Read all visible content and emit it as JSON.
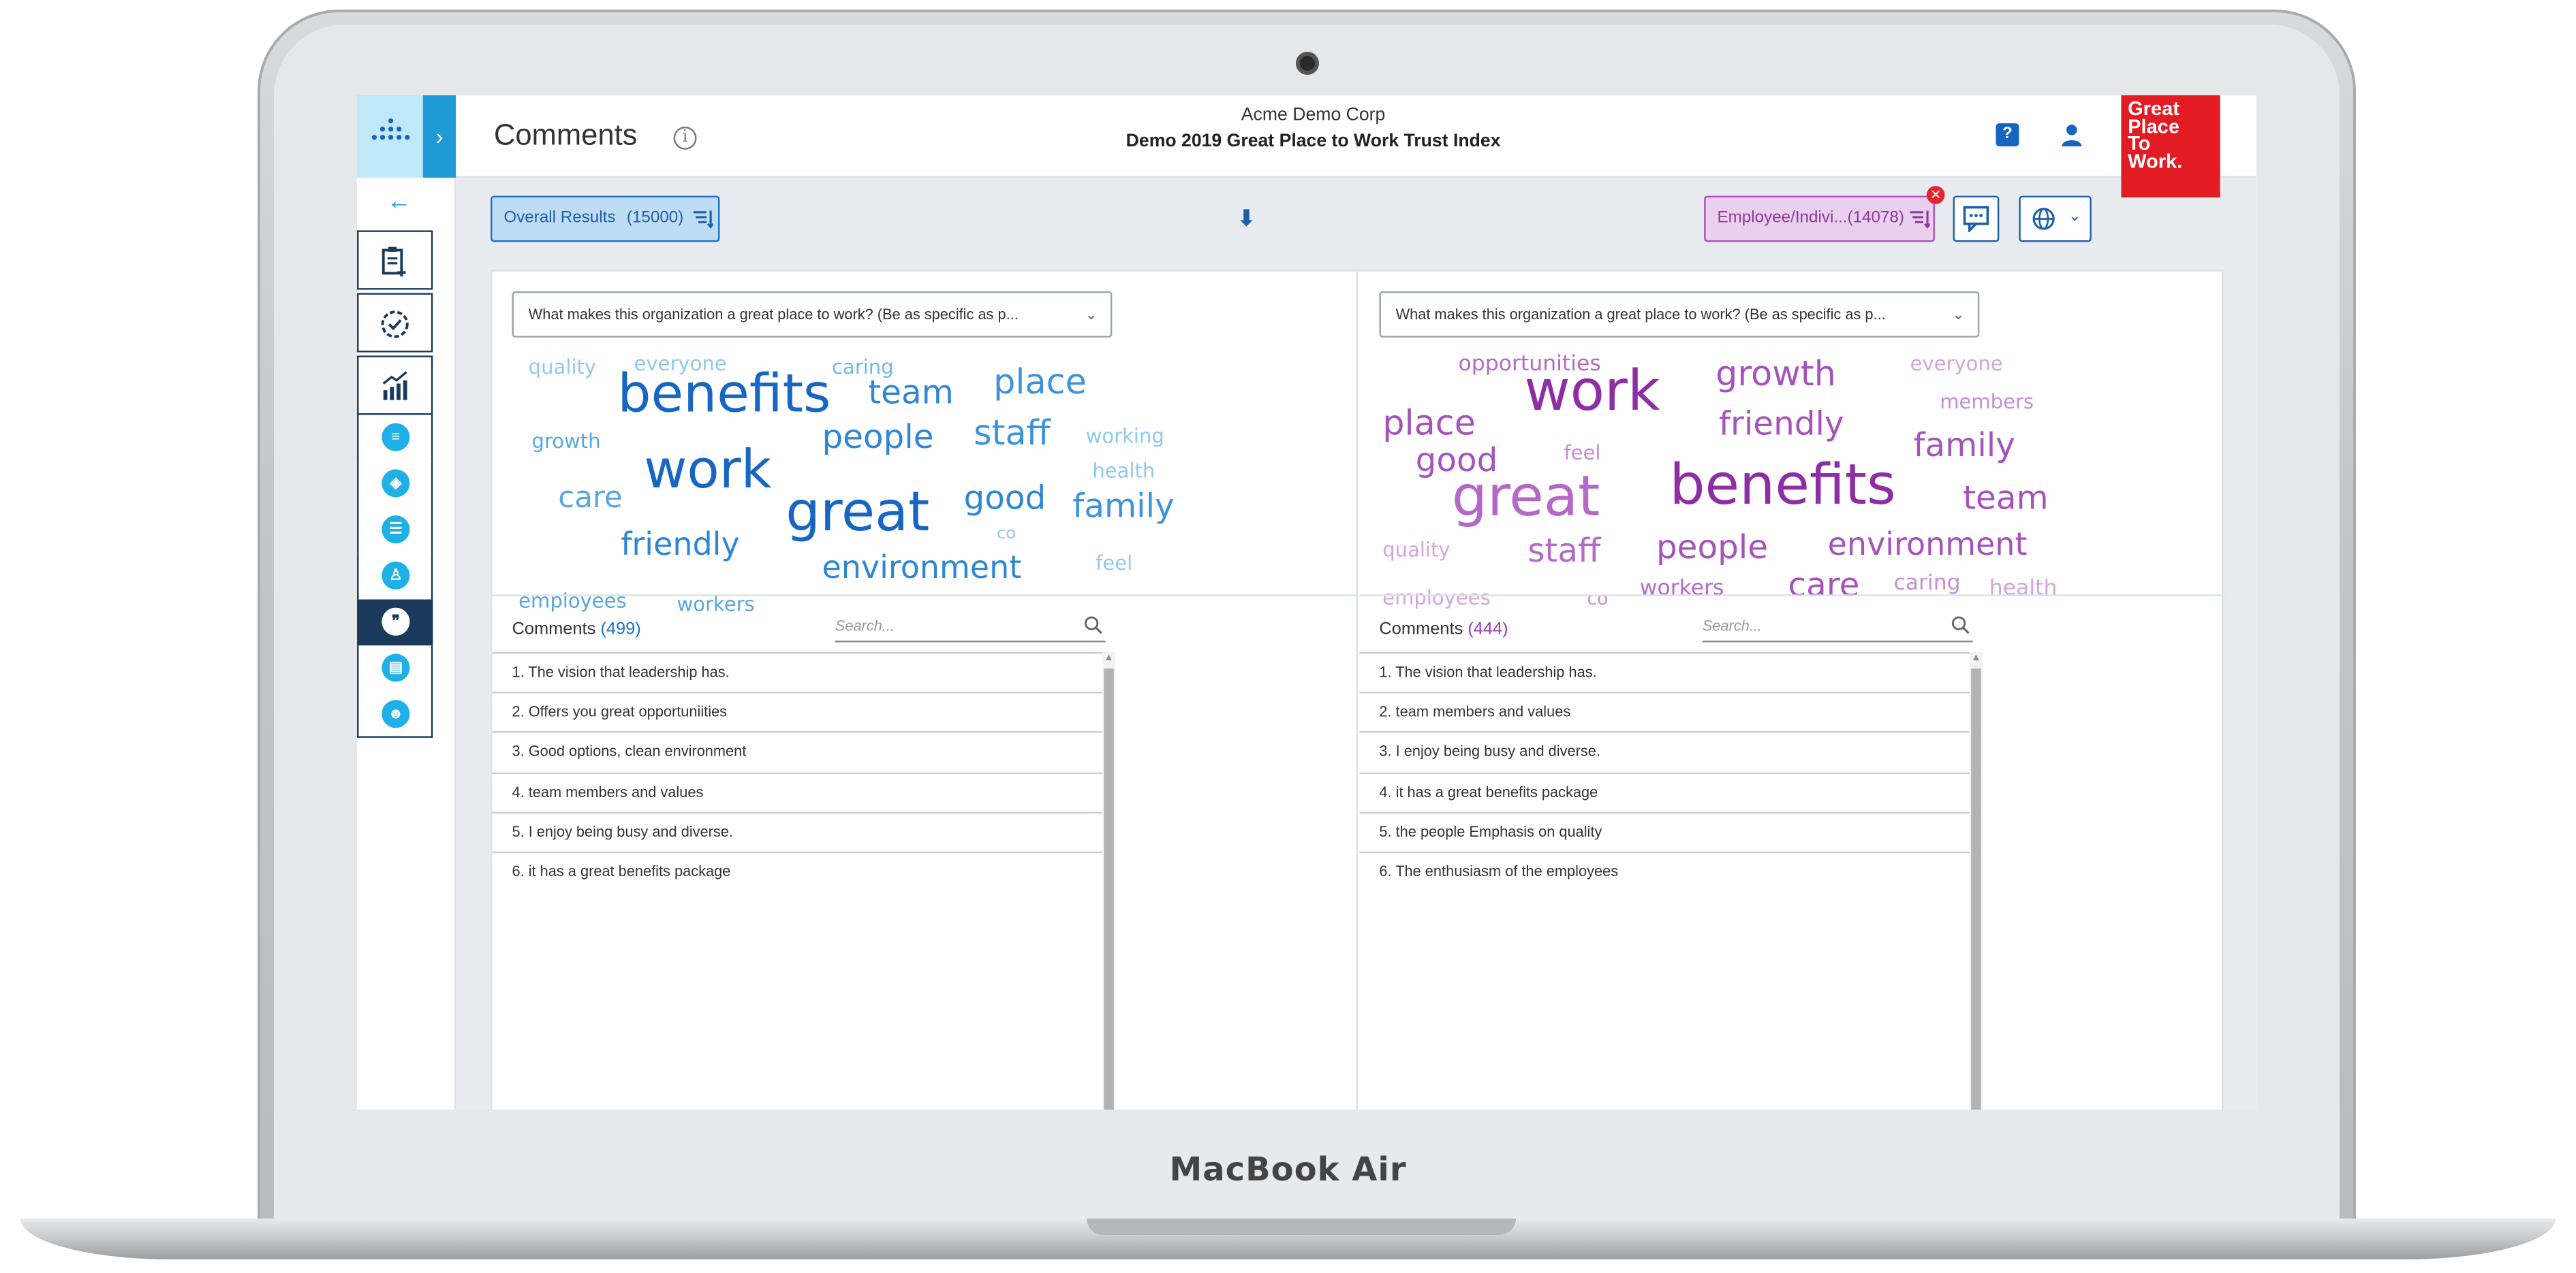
{
  "device": {
    "brand": "MacBook Air"
  },
  "header": {
    "title": "Comments",
    "company": "Acme Demo Corp",
    "survey": "Demo 2019 Great Place to Work Trust Index",
    "logo_lines": [
      "Great",
      "Place",
      "To",
      "Work."
    ]
  },
  "toolbar": {
    "left_filter": {
      "label": "Overall Results",
      "count": "(15000)"
    },
    "right_filter": {
      "label": "Employee/Indivi...",
      "count": "(14078)"
    }
  },
  "left": {
    "question": "What makes this organization a great place to work? (Be as specific as p...",
    "cloud_words": [
      {
        "text": "quality",
        "color": "#8fc9ee"
      },
      {
        "text": "everyone",
        "color": "#8fc9ee"
      },
      {
        "text": "caring",
        "color": "#6fb8e8"
      },
      {
        "text": "benefits",
        "color": "#1766c4"
      },
      {
        "text": "team",
        "color": "#2f86d4"
      },
      {
        "text": "place",
        "color": "#3c93da"
      },
      {
        "text": "growth",
        "color": "#58a6e0"
      },
      {
        "text": "people",
        "color": "#2f86d4"
      },
      {
        "text": "staff",
        "color": "#3c93da"
      },
      {
        "text": "working",
        "color": "#8fc9ee"
      },
      {
        "text": "work",
        "color": "#1766c4"
      },
      {
        "text": "health",
        "color": "#8fc9ee"
      },
      {
        "text": "care",
        "color": "#58a6e0"
      },
      {
        "text": "great",
        "color": "#1766c4"
      },
      {
        "text": "good",
        "color": "#2f86d4"
      },
      {
        "text": "family",
        "color": "#3c93da"
      },
      {
        "text": "co",
        "color": "#8fc9ee"
      },
      {
        "text": "friendly",
        "color": "#2f86d4"
      },
      {
        "text": "feel",
        "color": "#8fc9ee"
      },
      {
        "text": "environment",
        "color": "#2f86d4"
      },
      {
        "text": "employees",
        "color": "#58a6e0"
      },
      {
        "text": "workers",
        "color": "#58a6e0"
      }
    ],
    "comments_label": "Comments",
    "comments_count": "(499)",
    "search_placeholder": "Search...",
    "comments": [
      "1. The vision that leadership has.",
      "2. Offers you great opportuniities",
      "3. Good options, clean environment",
      "4. team members and values",
      "5. I enjoy being busy and diverse.",
      "6. it has a great benefits package"
    ]
  },
  "right": {
    "question": "What makes this organization a great place to work? (Be as specific as p...",
    "cloud_words": [
      {
        "text": "opportunities",
        "color": "#b469c7"
      },
      {
        "text": "work",
        "color": "#8e2ea5"
      },
      {
        "text": "growth",
        "color": "#a553bb"
      },
      {
        "text": "everyone",
        "color": "#d3a4de"
      },
      {
        "text": "members",
        "color": "#c78dd4"
      },
      {
        "text": "place",
        "color": "#a553bb"
      },
      {
        "text": "friendly",
        "color": "#a553bb"
      },
      {
        "text": "good",
        "color": "#a553bb"
      },
      {
        "text": "feel",
        "color": "#c78dd4"
      },
      {
        "text": "family",
        "color": "#a553bb"
      },
      {
        "text": "great",
        "color": "#b469c7"
      },
      {
        "text": "benefits",
        "color": "#8e2ea5"
      },
      {
        "text": "team",
        "color": "#a553bb"
      },
      {
        "text": "quality",
        "color": "#d3a4de"
      },
      {
        "text": "staff",
        "color": "#b469c7"
      },
      {
        "text": "people",
        "color": "#a553bb"
      },
      {
        "text": "environment",
        "color": "#a553bb"
      },
      {
        "text": "employees",
        "color": "#d3a4de"
      },
      {
        "text": "co",
        "color": "#c78dd4"
      },
      {
        "text": "workers",
        "color": "#b469c7"
      },
      {
        "text": "care",
        "color": "#a553bb"
      },
      {
        "text": "caring",
        "color": "#c78dd4"
      },
      {
        "text": "health",
        "color": "#d3a4de"
      }
    ],
    "comments_label": "Comments",
    "comments_count": "(444)",
    "search_placeholder": "Search...",
    "comments": [
      "1. The vision that leadership has.",
      "2. team members and values",
      "3. I enjoy being busy and diverse.",
      "4. it has a great benefits package",
      "5. the people Emphasis on quality",
      "6. The enthusiasm of the employees"
    ]
  }
}
